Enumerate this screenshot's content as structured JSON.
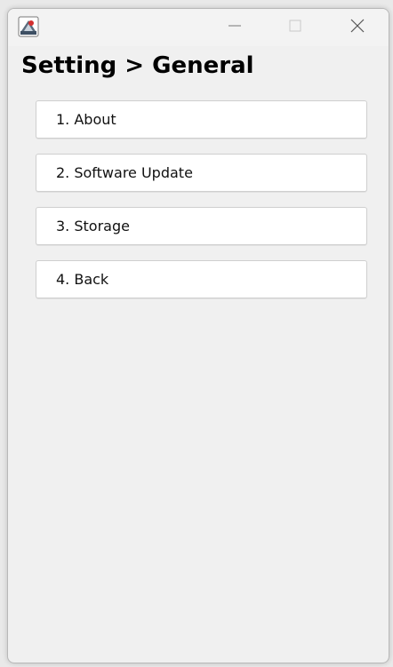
{
  "window": {
    "app_icon": "java-app-icon",
    "controls": {
      "minimize_icon": "minimize-icon",
      "maximize_icon": "maximize-icon",
      "close_icon": "close-icon"
    }
  },
  "page": {
    "title": "Setting > General"
  },
  "menu": {
    "items": [
      {
        "label": "1. About"
      },
      {
        "label": "2. Software Update"
      },
      {
        "label": "3. Storage"
      },
      {
        "label": "4. Back"
      }
    ]
  },
  "colors": {
    "window_bg": "#f0f0f0",
    "button_bg": "#ffffff",
    "button_border": "#cfcfcf",
    "text": "#000000"
  }
}
